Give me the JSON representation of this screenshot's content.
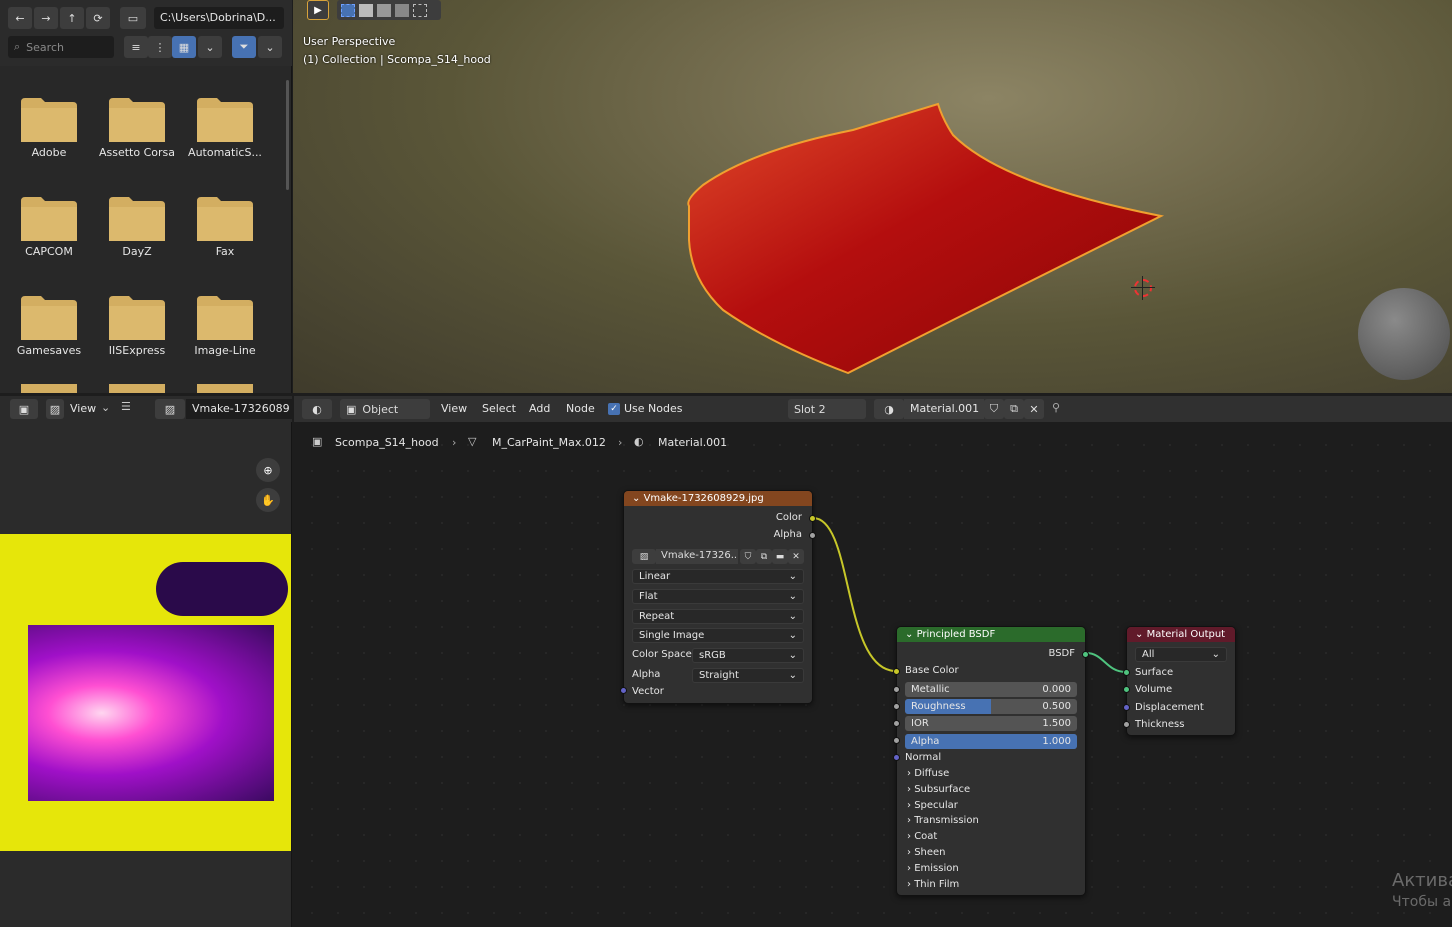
{
  "file_browser": {
    "path": "C:\\Users\\Dobrina\\D...",
    "search_placeholder": "Search",
    "folders": [
      "Adobe",
      "Assetto Corsa",
      "AutomaticS...",
      "CAPCOM",
      "DayZ",
      "Fax",
      "Gamesaves",
      "IISExpress",
      "Image-Line"
    ]
  },
  "viewport": {
    "mode_line": "User Perspective",
    "collection_line": "(1) Collection | Scompa_S14_hood"
  },
  "image_editor": {
    "view_label": "View",
    "image_name": "Vmake-17326089"
  },
  "node_editor": {
    "mode": "Object",
    "menu": [
      "View",
      "Select",
      "Add",
      "Node"
    ],
    "use_nodes": "Use Nodes",
    "slot": "Slot 2",
    "material": "Material.001",
    "breadcrumb": {
      "object": "Scompa_S14_hood",
      "mesh": "M_CarPaint_Max.012",
      "material": "Material.001"
    },
    "image_node": {
      "title": "Vmake-1732608929.jpg",
      "out_color": "Color",
      "out_alpha": "Alpha",
      "image_field": "Vmake-17326...",
      "interpolation": "Linear",
      "projection": "Flat",
      "extension": "Repeat",
      "source": "Single Image",
      "color_space_label": "Color Space",
      "color_space": "sRGB",
      "alpha_label": "Alpha",
      "alpha_mode": "Straight",
      "vector": "Vector"
    },
    "bsdf_node": {
      "title": "Principled BSDF",
      "out": "BSDF",
      "base_color": "Base Color",
      "fields": [
        {
          "label": "Metallic",
          "value": "0.000",
          "fill": 0.0
        },
        {
          "label": "Roughness",
          "value": "0.500",
          "fill": 0.5
        },
        {
          "label": "IOR",
          "value": "1.500",
          "fill": 0.0
        },
        {
          "label": "Alpha",
          "value": "1.000",
          "fill": 1.0
        }
      ],
      "normal": "Normal",
      "sections": [
        "Diffuse",
        "Subsurface",
        "Specular",
        "Transmission",
        "Coat",
        "Sheen",
        "Emission",
        "Thin Film"
      ]
    },
    "output_node": {
      "title": "Material Output",
      "target": "All",
      "inputs": [
        "Surface",
        "Volume",
        "Displacement",
        "Thickness"
      ]
    }
  },
  "watermark": {
    "line1": "Актива",
    "line2": "Чтобы а"
  },
  "colors": {
    "image_node": "#83461f",
    "bsdf_node": "#2b6b2b",
    "output_node": "#611a2a",
    "accent": "#4772b3"
  }
}
